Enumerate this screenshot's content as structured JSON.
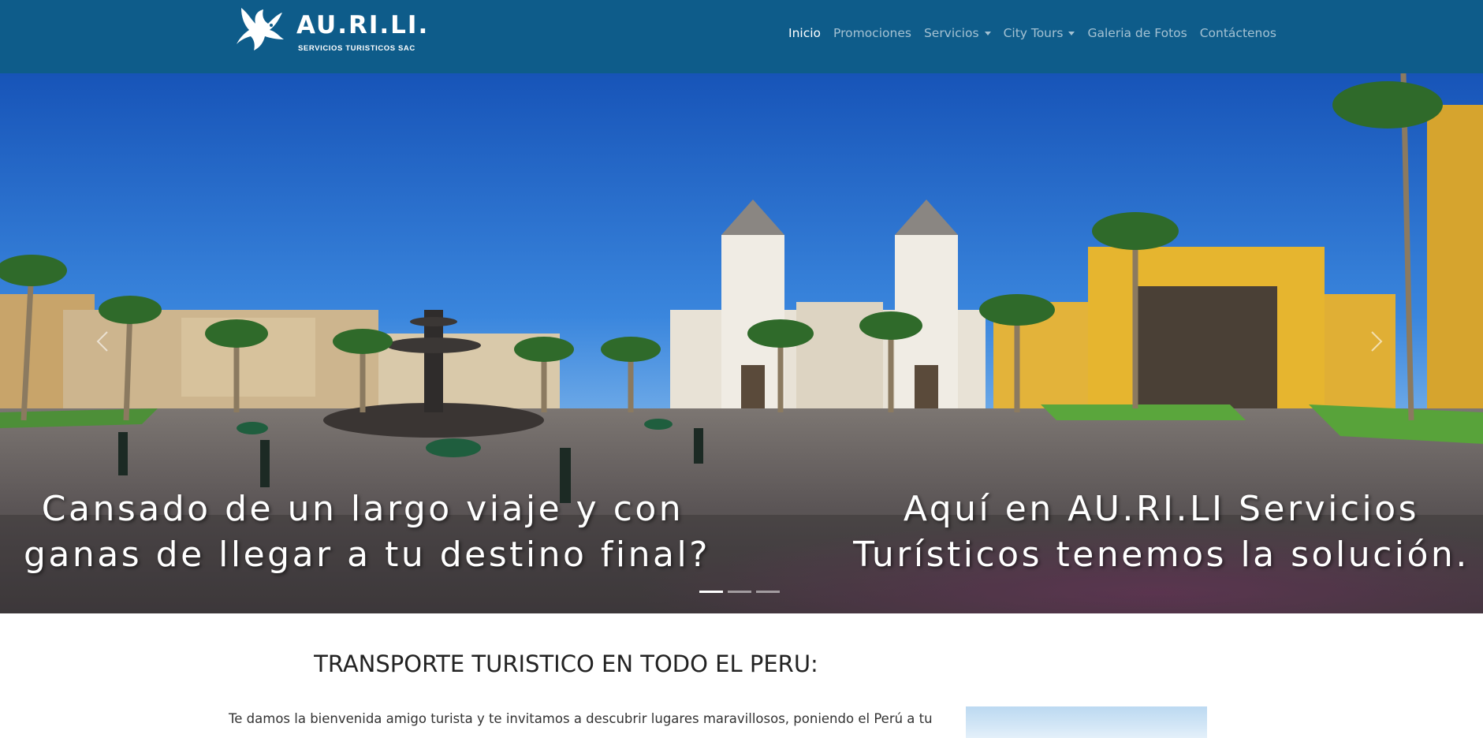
{
  "brand": {
    "name": "AU.RI.LI.",
    "subtitle": "SERVICIOS TURISTICOS SAC"
  },
  "nav": {
    "items": [
      {
        "label": "Inicio",
        "active": true
      },
      {
        "label": "Promociones"
      },
      {
        "label": "Servicios",
        "dropdown": true
      },
      {
        "label": "City Tours",
        "dropdown": true
      },
      {
        "label": "Galeria de Fotos"
      },
      {
        "label": "Contáctenos"
      }
    ]
  },
  "hero": {
    "caption_left_1": "Cansado de un largo viaje y con",
    "caption_left_2": "ganas de llegar a tu destino final?",
    "caption_right_1": "Aquí en AU.RI.LI Servicios",
    "caption_right_2": "Turísticos tenemos la solución.",
    "slides": 3,
    "active_slide": 1
  },
  "main": {
    "heading": "TRANSPORTE TURISTICO EN TODO EL PERU:",
    "intro": "Te damos la bienvenida amigo turista y te invitamos a descubrir lugares maravillosos, poniendo el Perú a tu"
  },
  "colors": {
    "navbar": "#0e5c8a",
    "nav_active": "#ffffff",
    "nav_inactive": "rgba(255,255,255,0.62)"
  }
}
